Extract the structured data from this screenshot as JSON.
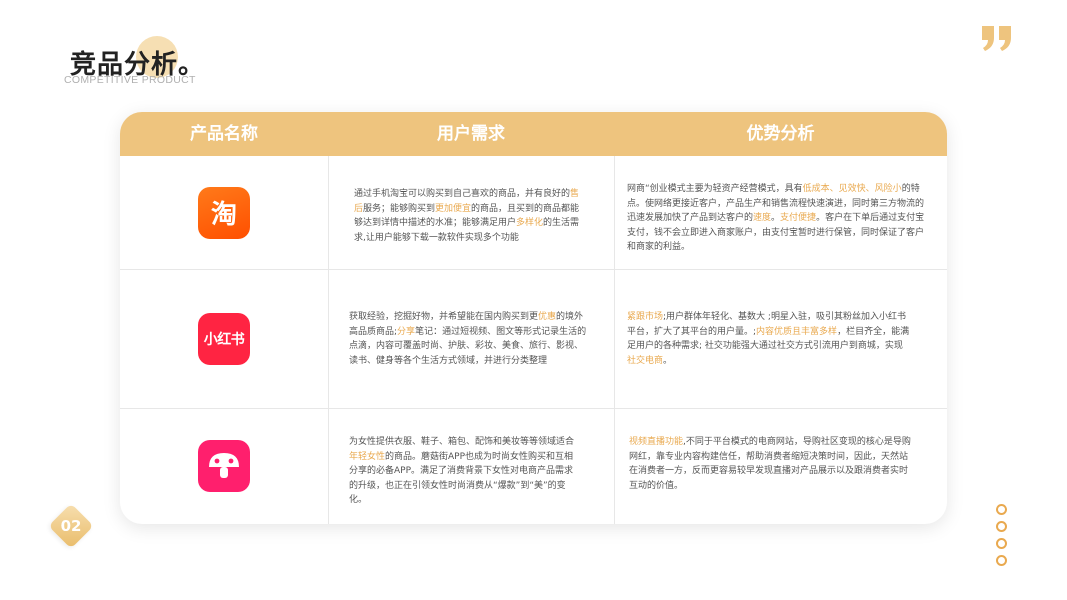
{
  "header": {
    "title": "竞品分析。",
    "subtitle": "COMPETITIVE PRODUCT"
  },
  "decor": {
    "quote_icon": "quote-mark-icon",
    "accent_color": "#eec47e",
    "highlight_color": "#e9a94f"
  },
  "table": {
    "columns": [
      "产品名称",
      "用户需求",
      "优势分析"
    ],
    "rows": [
      {
        "product_logo": "taobao-logo",
        "logo_text": "淘",
        "needs": [
          {
            "t": "通过手机淘宝可以购买到自己喜欢的商品，并有良好的"
          },
          {
            "t": "售后",
            "h": true
          },
          {
            "t": "服务；能够购买到"
          },
          {
            "t": "更加便宜",
            "h": true
          },
          {
            "t": "的商品，且买到的商品都能够达到详情中描述的水准；能够满足用户"
          },
          {
            "t": "多样化",
            "h": true
          },
          {
            "t": "的生活需求,让用户能够下载一款软件实现多个功能"
          }
        ],
        "advantages": [
          {
            "t": "网商“创业模式主要为轻资产经营模式，具有"
          },
          {
            "t": "低成本、见效快、风险小",
            "h": true
          },
          {
            "t": "的特点。使网络更接近客户，产品生产和销售流程快速演进，同时第三方物流的迅速发展加快了产品到达客户的"
          },
          {
            "t": "速度",
            "h": true
          },
          {
            "t": "。"
          },
          {
            "t": "支付便捷",
            "h": true
          },
          {
            "t": "。客户在下单后通过支付宝支付，钱不会立即进入商家账户，由支付宝暂时进行保管，同时保证了客户和商家的利益。"
          }
        ]
      },
      {
        "product_logo": "xiaohongshu-logo",
        "logo_text": "小红书",
        "needs": [
          {
            "t": "获取经验，挖掘好物，并希望能在国内购买到更"
          },
          {
            "t": "优惠",
            "h": true
          },
          {
            "t": "的境外高品质商品;"
          },
          {
            "t": "分享",
            "h": true
          },
          {
            "t": "笔记：通过短视频、图文等形式记录生活的点滴，内容可覆盖时尚、护肤、彩妆、美食、旅行、影视、读书、健身等各个生活方式领域，并进行分类整理"
          }
        ],
        "advantages": [
          {
            "t": "紧跟市场",
            "h": true
          },
          {
            "t": ";用户群体年轻化、基数大 ;明星入驻，吸引其粉丝加入小红书平台，扩大了其平台的用户量。;"
          },
          {
            "t": "内容优质且丰富多样",
            "h": true
          },
          {
            "t": "，栏目齐全，能满足用户的各种需求; 社交功能强大通过社交方式引流用户到商城，实现"
          },
          {
            "t": "社交电商",
            "h": true
          },
          {
            "t": "。"
          }
        ]
      },
      {
        "product_logo": "mogujie-logo",
        "logo_text": "",
        "needs": [
          {
            "t": "为女性提供衣服、鞋子、箱包、配饰和美妆等等领域适合"
          },
          {
            "t": "年轻女性",
            "h": true
          },
          {
            "t": "的商品。蘑菇街APP也成为时尚女性购买和互相分享的必备APP。满足了消费背景下女性对电商产品需求的升级，也正在引领女性时尚消费从“爆款”到“美”的变化。"
          }
        ],
        "advantages": [
          {
            "t": "视频直播功能",
            "h": true
          },
          {
            "t": ",不同于平台模式的电商网站，导购社区变现的核心是导购网红，靠专业内容构建信任，帮助消费者缩短决策时间，因此，天然站在消费者一方，反而更容易较早发现直播对产品展示以及跟消费者实时互动的价值。"
          }
        ]
      }
    ]
  },
  "page_number": "02"
}
